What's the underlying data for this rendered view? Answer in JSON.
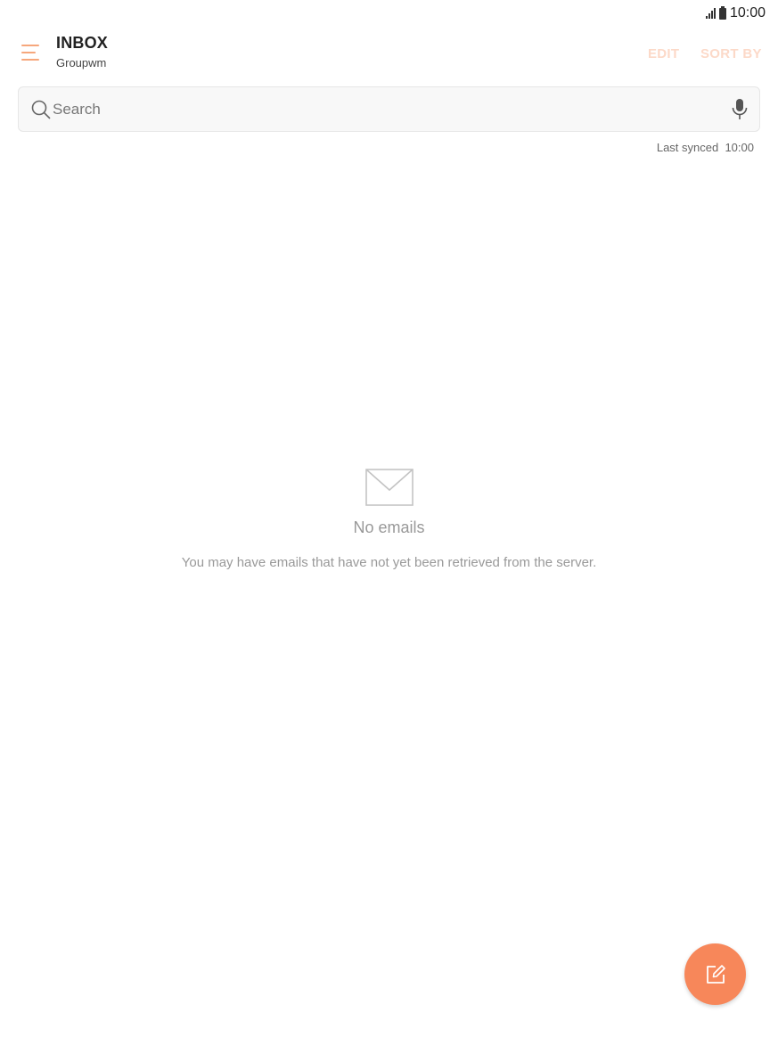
{
  "status_bar": {
    "time": "10:00"
  },
  "header": {
    "title": "INBOX",
    "subtitle": "Groupwm",
    "edit_label": "EDIT",
    "sort_label": "SORT BY"
  },
  "search": {
    "placeholder": "Search",
    "value": ""
  },
  "sync": {
    "label": "Last synced",
    "time": "10:00"
  },
  "empty_state": {
    "title": "No emails",
    "description": "You may have emails that have not yet been retrieved from the server."
  },
  "icons": {
    "menu": "hamburger-menu-icon",
    "search": "search-icon",
    "mic": "microphone-icon",
    "empty": "envelope-icon",
    "compose": "compose-icon"
  },
  "colors": {
    "accent": "#f7875a",
    "menu_icon": "#f6a77c",
    "disabled_action": "#fcd9c8"
  }
}
